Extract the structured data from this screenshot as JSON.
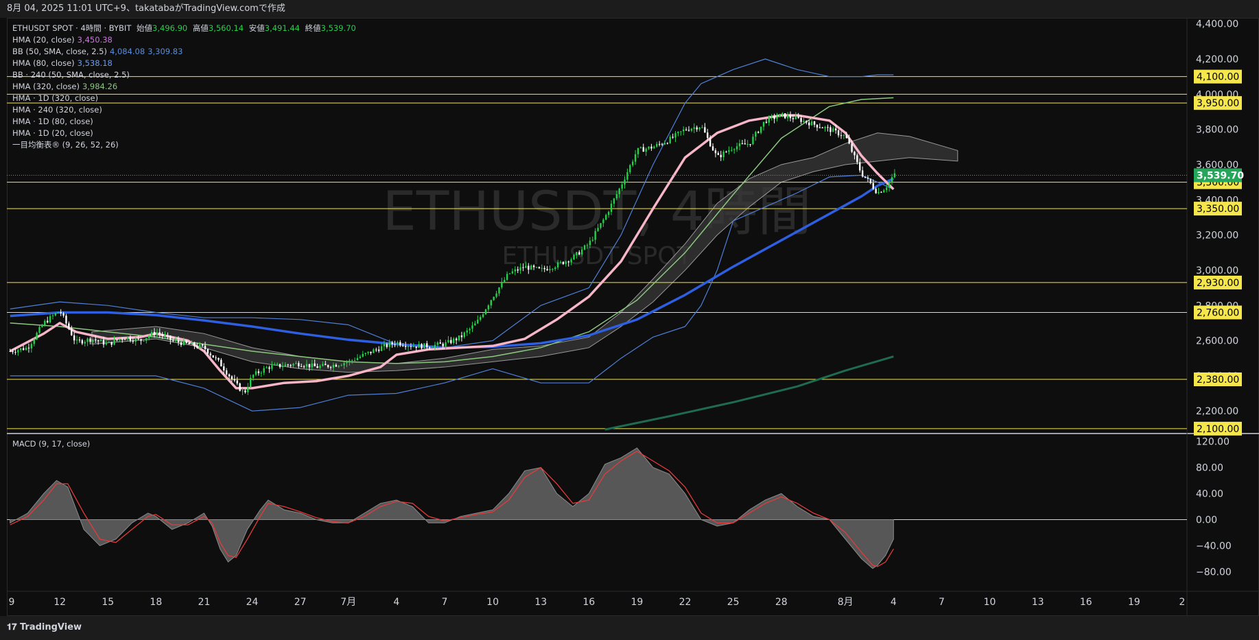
{
  "header": {
    "caption": "8月 04, 2025 11:01 UTC+9、takatabaがTradingView.comで作成"
  },
  "legend": {
    "main": {
      "symbol": "ETHUSDT SPOT · 4時間 · BYBIT",
      "open_label": "始値",
      "open": "3,496.90",
      "high_label": "高値",
      "high": "3,560.14",
      "low_label": "安値",
      "low": "3,491.44",
      "close_label": "終値",
      "close": "3,539.70"
    },
    "indicators": [
      {
        "name": "HMA (20, close)",
        "value": "3,450.38",
        "color": "#c77ad6"
      },
      {
        "name": "BB (50, SMA, close, 2.5)",
        "value": "4,084.08",
        "value2": "3,309.83",
        "color": "#5b8dd8"
      },
      {
        "name": "HMA (80, close)",
        "value": "3,538.18",
        "color": "#6e9cf0"
      },
      {
        "name": "BB · 240 (50, SMA, close, 2.5)",
        "value": "",
        "color": "#d1d4dc"
      },
      {
        "name": "HMA (320, close)",
        "value": "3,984.26",
        "color": "#8bc77f"
      },
      {
        "name": "HMA · 1D (320, close)",
        "value": "",
        "color": "#d1d4dc"
      },
      {
        "name": "HMA · 240 (320, close)",
        "value": "",
        "color": "#d1d4dc"
      },
      {
        "name": "HMA · 1D (80, close)",
        "value": "",
        "color": "#d1d4dc"
      },
      {
        "name": "HMA · 1D (20, close)",
        "value": "",
        "color": "#d1d4dc"
      },
      {
        "name": "一目均衡表® (9, 26, 52, 26)",
        "value": "",
        "color": "#d1d4dc"
      }
    ]
  },
  "watermark": {
    "line1": "ETHUSDT, 4時間",
    "line2": "ETHUSDT SPOT"
  },
  "macd_label": "MACD (9, 17, close)",
  "footer": {
    "brand": "TradingView"
  },
  "colors": {
    "up": "#26d04a",
    "down": "#ffffff",
    "hline": "#f5e64b",
    "hma80": "#2e5fe0",
    "hma20": "#f7b6c8",
    "macd": "#e33b3b"
  },
  "chart_data": [
    {
      "type": "line",
      "title": "ETHUSDT SPOT · 4時間 · BYBIT",
      "ylim": [
        2080,
        4430
      ],
      "price_axis_ticks": [
        "4,400.00",
        "4,200.00",
        "4,000.00",
        "3,800.00",
        "3,600.00",
        "3,400.00",
        "3,200.00",
        "3,000.00",
        "2,800.00",
        "2,600.00",
        "2,400.00",
        "2,200.00"
      ],
      "price_axis_values": [
        4400,
        4200,
        4000,
        3800,
        3600,
        3400,
        3200,
        3000,
        2800,
        2600,
        2400,
        2200
      ],
      "horizontal_levels": [
        {
          "label": "4,100.00",
          "value": 4100
        },
        {
          "label": "3,950.00",
          "value": 3950
        },
        {
          "label": "3,500.00",
          "value": 3500
        },
        {
          "label": "3,350.00",
          "value": 3350
        },
        {
          "label": "2,930.00",
          "value": 2930
        },
        {
          "label": "2,760.00",
          "value": 2760
        },
        {
          "label": "2,380.00",
          "value": 2380
        },
        {
          "label": "2,100.00",
          "value": 2100
        }
      ],
      "extra_levels": [
        {
          "value": 4000
        }
      ],
      "current_price": {
        "label": "3,539.70",
        "value": 3539.7
      },
      "x_ticks": [
        "9",
        "12",
        "15",
        "18",
        "21",
        "24",
        "27",
        "7月",
        "4",
        "7",
        "10",
        "13",
        "16",
        "19",
        "22",
        "25",
        "28",
        "8月",
        "4",
        "7",
        "10",
        "13",
        "16",
        "19",
        "2"
      ],
      "x_tick_values": [
        9,
        12,
        15,
        18,
        21,
        24,
        27,
        30,
        33,
        36,
        39,
        42,
        45,
        48,
        51,
        54,
        57,
        61,
        64,
        67,
        70,
        73,
        76,
        79,
        82
      ],
      "xlim": [
        8.7,
        82.3
      ],
      "x_last": 64.1,
      "series": [
        {
          "name": "HMA (80, close)",
          "x": [
            8.9,
            12,
            15,
            18,
            21,
            24,
            27,
            30,
            33,
            36,
            39,
            42,
            45,
            48,
            51,
            54,
            57,
            60,
            62,
            63,
            64
          ],
          "y": [
            2740,
            2760,
            2760,
            2745,
            2715,
            2680,
            2640,
            2605,
            2580,
            2560,
            2565,
            2585,
            2630,
            2720,
            2860,
            3020,
            3170,
            3320,
            3420,
            3480,
            3520
          ]
        },
        {
          "name": "HMA (20, close)",
          "x": [
            8.9,
            11,
            12,
            13,
            15,
            17,
            18,
            20,
            21,
            22,
            23,
            24,
            26,
            28,
            30,
            32,
            33,
            35,
            37,
            39,
            41,
            43,
            45,
            47,
            49,
            51,
            53,
            55,
            57,
            58,
            60,
            61,
            62,
            63,
            64
          ],
          "y": [
            2540,
            2640,
            2700,
            2650,
            2610,
            2620,
            2640,
            2600,
            2540,
            2430,
            2330,
            2330,
            2360,
            2370,
            2400,
            2450,
            2520,
            2550,
            2560,
            2570,
            2610,
            2720,
            2850,
            3050,
            3350,
            3640,
            3780,
            3850,
            3880,
            3880,
            3850,
            3780,
            3650,
            3550,
            3460
          ]
        },
        {
          "name": "HMA (320, close)",
          "x": [
            8.9,
            12,
            15,
            18,
            21,
            24,
            27,
            30,
            33,
            36,
            39,
            42,
            45,
            48,
            51,
            54,
            57,
            60,
            62,
            63,
            64
          ],
          "y": [
            2700,
            2680,
            2650,
            2620,
            2580,
            2540,
            2510,
            2480,
            2470,
            2480,
            2510,
            2560,
            2650,
            2830,
            3100,
            3430,
            3750,
            3930,
            3970,
            3975,
            3980
          ]
        },
        {
          "name": "HMA · 1D (320, close)",
          "x": [
            46,
            50,
            54,
            58,
            61,
            64
          ],
          "y": [
            2095,
            2170,
            2250,
            2340,
            2430,
            2510
          ]
        },
        {
          "name": "BB (50, SMA, close, 2.5) upper",
          "x": [
            8.9,
            12,
            15,
            18,
            21,
            24,
            27,
            30,
            33,
            36,
            39,
            42,
            45,
            47,
            49,
            51,
            52,
            54,
            56,
            58,
            60,
            62,
            63,
            64
          ],
          "y": [
            2780,
            2820,
            2800,
            2760,
            2730,
            2730,
            2720,
            2690,
            2580,
            2560,
            2600,
            2800,
            2900,
            3200,
            3600,
            3950,
            4060,
            4140,
            4200,
            4140,
            4100,
            4100,
            4110,
            4110
          ]
        },
        {
          "name": "BB (50, SMA, close, 2.5) lower",
          "x": [
            8.9,
            12,
            15,
            18,
            21,
            24,
            27,
            30,
            33,
            36,
            39,
            42,
            45,
            47,
            49,
            51,
            52,
            53,
            54,
            56,
            58,
            60,
            62,
            63,
            64
          ],
          "y": [
            2400,
            2400,
            2400,
            2400,
            2330,
            2200,
            2220,
            2290,
            2300,
            2360,
            2440,
            2360,
            2360,
            2500,
            2620,
            2680,
            2800,
            3000,
            3280,
            3360,
            3440,
            3530,
            3540,
            3500,
            3460
          ]
        },
        {
          "name": "Ichimoku cloud A",
          "x": [
            14,
            18,
            21,
            24,
            27,
            30,
            33,
            36,
            39,
            42,
            45,
            47,
            49,
            51,
            53,
            55,
            57,
            59,
            61,
            63,
            65,
            68
          ],
          "y": [
            2650,
            2680,
            2640,
            2560,
            2510,
            2480,
            2470,
            2500,
            2550,
            2570,
            2620,
            2760,
            2950,
            3150,
            3380,
            3520,
            3600,
            3640,
            3720,
            3780,
            3760,
            3680
          ]
        },
        {
          "name": "Ichimoku cloud B",
          "x": [
            14,
            18,
            21,
            24,
            27,
            30,
            33,
            36,
            39,
            42,
            45,
            47,
            49,
            51,
            53,
            55,
            57,
            59,
            61,
            63,
            65,
            68
          ],
          "y": [
            2580,
            2610,
            2560,
            2480,
            2440,
            2420,
            2430,
            2450,
            2480,
            2510,
            2560,
            2680,
            2820,
            3000,
            3200,
            3360,
            3500,
            3560,
            3600,
            3620,
            3640,
            3620
          ]
        }
      ],
      "candles_close_path": {
        "x": [
          8.9,
          10,
          11,
          12,
          13,
          14,
          15,
          16,
          17,
          18,
          19,
          20,
          21,
          22,
          23,
          23.5,
          24,
          25,
          26,
          27,
          28,
          29,
          30,
          31,
          32,
          33,
          34,
          35,
          36,
          37,
          38,
          39,
          40,
          41,
          42,
          43,
          44,
          45,
          46,
          47,
          48,
          49,
          50,
          51,
          52,
          53,
          54,
          55,
          56,
          57,
          58,
          59,
          60,
          61,
          62,
          62.5,
          63,
          63.5,
          64
        ],
        "y": [
          2540,
          2560,
          2700,
          2770,
          2590,
          2610,
          2580,
          2620,
          2600,
          2650,
          2600,
          2580,
          2560,
          2470,
          2350,
          2300,
          2400,
          2450,
          2460,
          2470,
          2450,
          2460,
          2480,
          2520,
          2560,
          2590,
          2570,
          2570,
          2580,
          2620,
          2700,
          2850,
          2980,
          3020,
          3000,
          3030,
          3070,
          3150,
          3300,
          3480,
          3680,
          3700,
          3740,
          3800,
          3820,
          3640,
          3700,
          3720,
          3850,
          3880,
          3860,
          3830,
          3800,
          3760,
          3550,
          3500,
          3440,
          3470,
          3540
        ]
      }
    },
    {
      "type": "area",
      "title": "MACD (9, 17, close)",
      "ylim": [
        -110,
        130
      ],
      "axis_ticks": [
        "120.00",
        "80.00",
        "40.00",
        "0.00",
        "−40.00",
        "−80.00"
      ],
      "axis_values": [
        120,
        80,
        40,
        0,
        -40,
        -80
      ],
      "x": [
        8.9,
        10,
        11,
        11.8,
        12.5,
        13.5,
        14.5,
        15.5,
        16.5,
        17.5,
        18,
        19,
        20,
        21,
        21.5,
        22,
        22.5,
        23,
        23.7,
        24.5,
        25,
        26,
        27,
        28,
        29,
        30,
        31,
        32,
        33,
        34,
        35,
        36,
        37,
        38,
        39,
        40,
        41,
        42,
        43,
        44,
        45,
        46,
        47,
        48,
        49,
        50,
        51,
        52,
        53,
        54,
        55,
        56,
        57,
        58,
        59,
        60,
        61,
        62,
        62.7,
        63,
        63.5,
        64
      ],
      "histogram": [
        -5,
        10,
        40,
        60,
        50,
        -15,
        -40,
        -30,
        -5,
        10,
        5,
        -15,
        -5,
        10,
        -10,
        -45,
        -65,
        -55,
        -15,
        15,
        30,
        15,
        10,
        0,
        -5,
        -5,
        10,
        25,
        30,
        20,
        -5,
        -5,
        5,
        10,
        15,
        40,
        75,
        80,
        40,
        20,
        40,
        85,
        95,
        110,
        80,
        70,
        40,
        0,
        -10,
        -5,
        15,
        30,
        40,
        20,
        5,
        0,
        -30,
        -60,
        -75,
        -70,
        -55,
        -30
      ],
      "signal": [
        -8,
        5,
        30,
        55,
        55,
        10,
        -30,
        -35,
        -15,
        5,
        8,
        -8,
        -8,
        5,
        -5,
        -35,
        -55,
        -58,
        -30,
        5,
        25,
        20,
        12,
        3,
        -3,
        -5,
        5,
        20,
        28,
        25,
        5,
        -2,
        3,
        8,
        12,
        30,
        65,
        80,
        55,
        25,
        30,
        70,
        90,
        105,
        90,
        75,
        50,
        10,
        -5,
        -5,
        10,
        25,
        35,
        25,
        10,
        0,
        -20,
        -50,
        -70,
        -72,
        -65,
        -45
      ]
    }
  ]
}
